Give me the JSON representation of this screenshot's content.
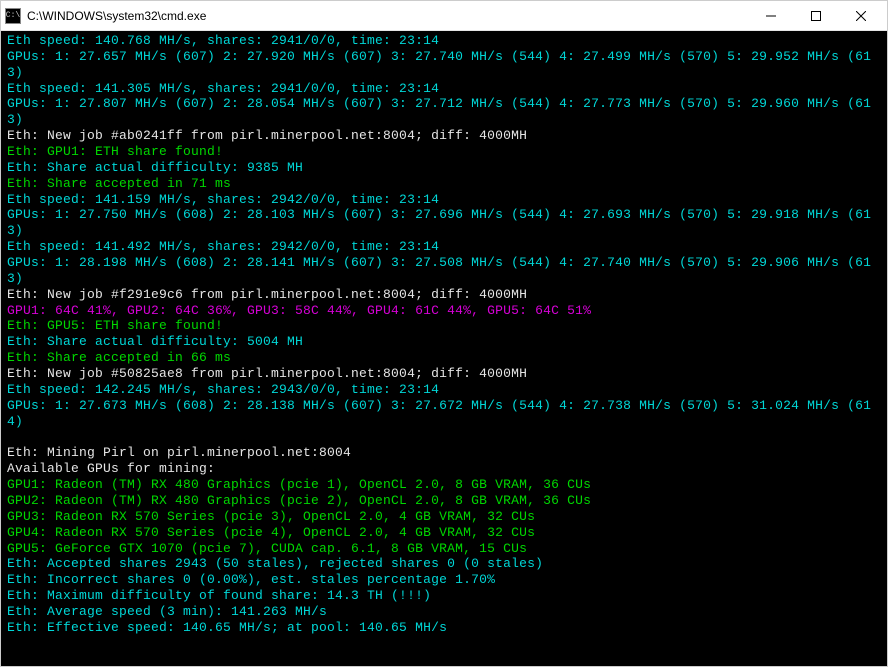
{
  "window": {
    "title": "C:\\WINDOWS\\system32\\cmd.exe",
    "icon_label": "cmd-icon"
  },
  "controls": {
    "minimize": "—",
    "maximize": "☐",
    "close": "✕"
  },
  "lines": [
    {
      "cls": "cyan",
      "text": "Eth speed: 140.768 MH/s, shares: 2941/0/0, time: 23:14"
    },
    {
      "cls": "cyan",
      "text": "GPUs: 1: 27.657 MH/s (607) 2: 27.920 MH/s (607) 3: 27.740 MH/s (544) 4: 27.499 MH/s (570) 5: 29.952 MH/s (613)"
    },
    {
      "cls": "cyan",
      "text": "Eth speed: 141.305 MH/s, shares: 2941/0/0, time: 23:14"
    },
    {
      "cls": "cyan",
      "text": "GPUs: 1: 27.807 MH/s (607) 2: 28.054 MH/s (607) 3: 27.712 MH/s (544) 4: 27.773 MH/s (570) 5: 29.960 MH/s (613)"
    },
    {
      "cls": "white",
      "text": "Eth: New job #ab0241ff from pirl.minerpool.net:8004; diff: 4000MH"
    },
    {
      "cls": "green",
      "text": "Eth: GPU1: ETH share found!"
    },
    {
      "cls": "cyan",
      "text": "Eth: Share actual difficulty: 9385 MH"
    },
    {
      "cls": "green",
      "text": "Eth: Share accepted in 71 ms"
    },
    {
      "cls": "cyan",
      "text": "Eth speed: 141.159 MH/s, shares: 2942/0/0, time: 23:14"
    },
    {
      "cls": "cyan",
      "text": "GPUs: 1: 27.750 MH/s (608) 2: 28.103 MH/s (607) 3: 27.696 MH/s (544) 4: 27.693 MH/s (570) 5: 29.918 MH/s (613)"
    },
    {
      "cls": "cyan",
      "text": "Eth speed: 141.492 MH/s, shares: 2942/0/0, time: 23:14"
    },
    {
      "cls": "cyan",
      "text": "GPUs: 1: 28.198 MH/s (608) 2: 28.141 MH/s (607) 3: 27.508 MH/s (544) 4: 27.740 MH/s (570) 5: 29.906 MH/s (613)"
    },
    {
      "cls": "white",
      "text": "Eth: New job #f291e9c6 from pirl.minerpool.net:8004; diff: 4000MH"
    },
    {
      "cls": "magenta",
      "text": "GPU1: 64C 41%, GPU2: 64C 36%, GPU3: 58C 44%, GPU4: 61C 44%, GPU5: 64C 51%"
    },
    {
      "cls": "green",
      "text": "Eth: GPU5: ETH share found!"
    },
    {
      "cls": "cyan",
      "text": "Eth: Share actual difficulty: 5004 MH"
    },
    {
      "cls": "green",
      "text": "Eth: Share accepted in 66 ms"
    },
    {
      "cls": "white",
      "text": "Eth: New job #50825ae8 from pirl.minerpool.net:8004; diff: 4000MH"
    },
    {
      "cls": "cyan",
      "text": "Eth speed: 142.245 MH/s, shares: 2943/0/0, time: 23:14"
    },
    {
      "cls": "cyan",
      "text": "GPUs: 1: 27.673 MH/s (608) 2: 28.138 MH/s (607) 3: 27.672 MH/s (544) 4: 27.738 MH/s (570) 5: 31.024 MH/s (614)"
    },
    {
      "cls": "white",
      "text": " "
    },
    {
      "cls": "white",
      "text": "Eth: Mining Pirl on pirl.minerpool.net:8004"
    },
    {
      "cls": "white",
      "text": "Available GPUs for mining:"
    },
    {
      "cls": "green",
      "text": "GPU1: Radeon (TM) RX 480 Graphics (pcie 1), OpenCL 2.0, 8 GB VRAM, 36 CUs"
    },
    {
      "cls": "green",
      "text": "GPU2: Radeon (TM) RX 480 Graphics (pcie 2), OpenCL 2.0, 8 GB VRAM, 36 CUs"
    },
    {
      "cls": "green",
      "text": "GPU3: Radeon RX 570 Series (pcie 3), OpenCL 2.0, 4 GB VRAM, 32 CUs"
    },
    {
      "cls": "green",
      "text": "GPU4: Radeon RX 570 Series (pcie 4), OpenCL 2.0, 4 GB VRAM, 32 CUs"
    },
    {
      "cls": "green",
      "text": "GPU5: GeForce GTX 1070 (pcie 7), CUDA cap. 6.1, 8 GB VRAM, 15 CUs"
    },
    {
      "cls": "cyan",
      "text": "Eth: Accepted shares 2943 (50 stales), rejected shares 0 (0 stales)"
    },
    {
      "cls": "cyan",
      "text": "Eth: Incorrect shares 0 (0.00%), est. stales percentage 1.70%"
    },
    {
      "cls": "cyan",
      "text": "Eth: Maximum difficulty of found share: 14.3 TH (!!!)"
    },
    {
      "cls": "cyan",
      "text": "Eth: Average speed (3 min): 141.263 MH/s"
    },
    {
      "cls": "cyan",
      "text": "Eth: Effective speed: 140.65 MH/s; at pool: 140.65 MH/s"
    }
  ]
}
